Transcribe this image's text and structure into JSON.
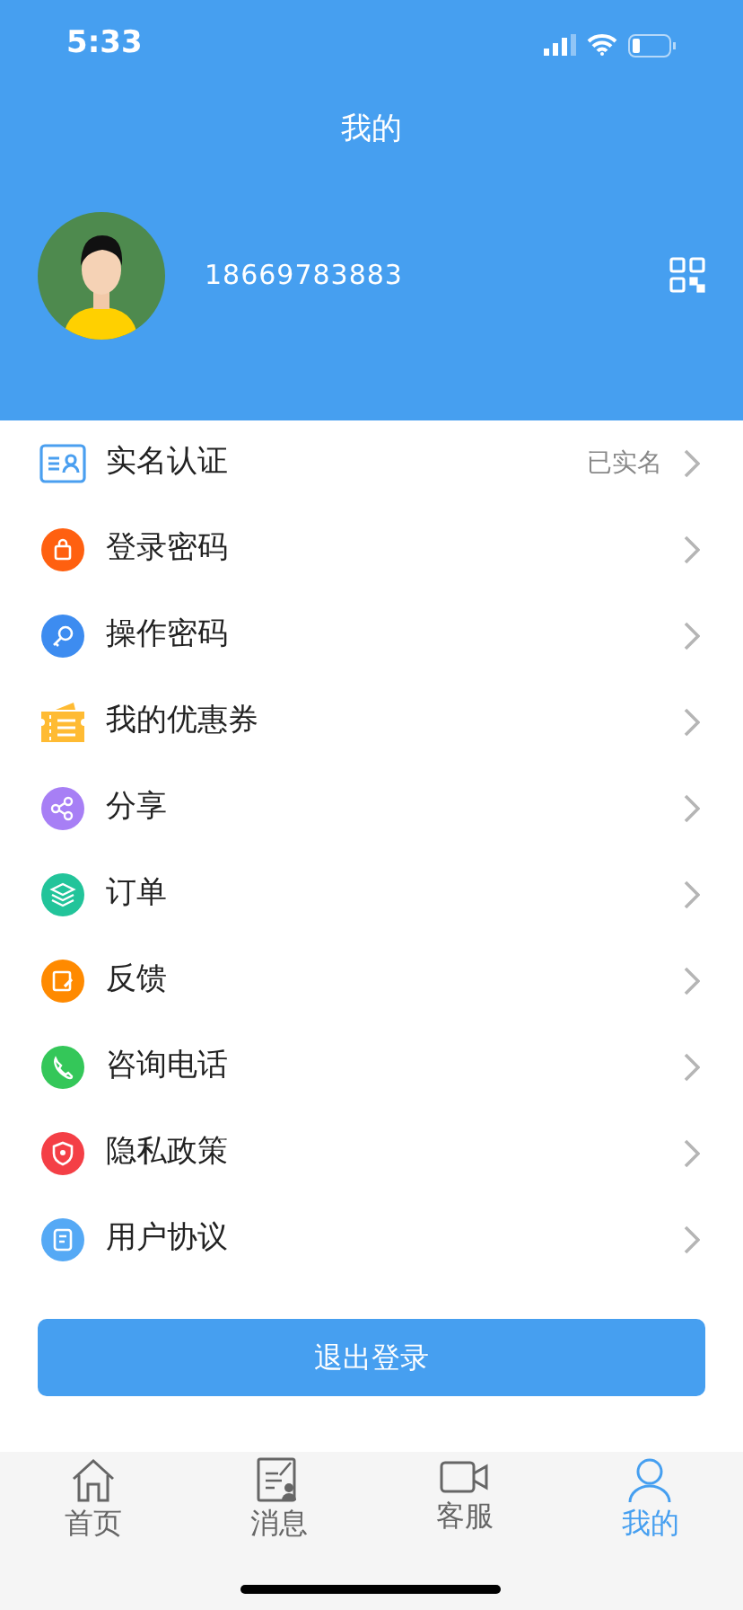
{
  "status_bar": {
    "time": "5:33"
  },
  "header": {
    "title": "我的"
  },
  "profile": {
    "phone": "18669783883"
  },
  "menu": [
    {
      "label": "实名认证",
      "value": "已实名",
      "color": "#4a9ff0"
    },
    {
      "label": "登录密码",
      "color": "#ff6010"
    },
    {
      "label": "操作密码",
      "color": "#3d8cf0"
    },
    {
      "label": "我的优惠券",
      "color": "#ffbb33"
    },
    {
      "label": "分享",
      "color": "#a77ff5"
    },
    {
      "label": "订单",
      "color": "#22c49a"
    },
    {
      "label": "反馈",
      "color": "#ff8a00"
    },
    {
      "label": "咨询电话",
      "color": "#34c759"
    },
    {
      "label": "隐私政策",
      "color": "#f43f46"
    },
    {
      "label": "用户协议",
      "color": "#55a9f5"
    }
  ],
  "logout_button": "退出登录",
  "tabs": [
    {
      "label": "首页",
      "selected": false
    },
    {
      "label": "消息",
      "selected": false
    },
    {
      "label": "客服",
      "selected": false
    },
    {
      "label": "我的",
      "selected": true
    }
  ]
}
